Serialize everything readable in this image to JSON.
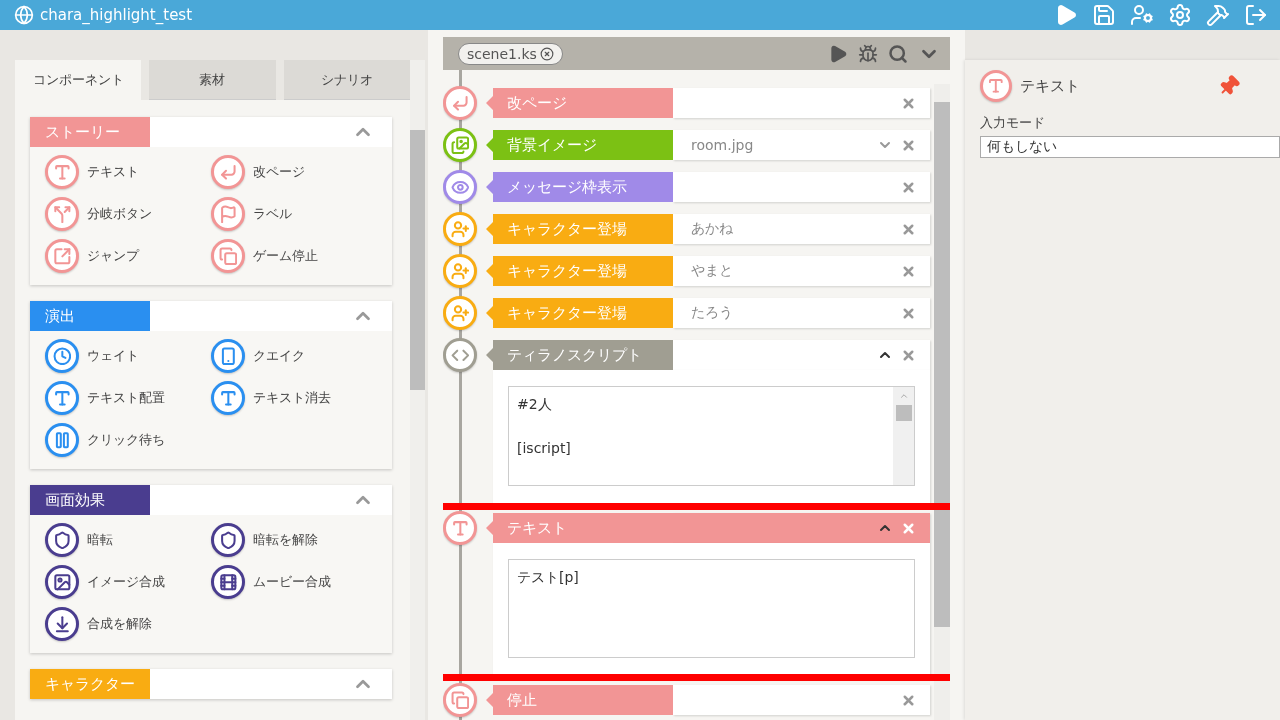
{
  "window": {
    "title": "chara_highlight_test"
  },
  "left_panel": {
    "tabs": [
      {
        "label": "コンポーネント",
        "selected": true
      },
      {
        "label": "素材",
        "selected": false
      },
      {
        "label": "シナリオ",
        "selected": false
      }
    ],
    "sections": [
      {
        "title": "ストーリー",
        "color": "#f29595",
        "items": [
          {
            "label": "テキスト",
            "kind": "text"
          },
          {
            "label": "改ページ",
            "kind": "newpage"
          },
          {
            "label": "分岐ボタン",
            "kind": "branch"
          },
          {
            "label": "ラベル",
            "kind": "label"
          },
          {
            "label": "ジャンプ",
            "kind": "jump"
          },
          {
            "label": "ゲーム停止",
            "kind": "stop"
          }
        ]
      },
      {
        "title": "演出",
        "color": "#2a8ff0",
        "items": [
          {
            "label": "ウェイト",
            "kind": "wait"
          },
          {
            "label": "クエイク",
            "kind": "quake"
          },
          {
            "label": "テキスト配置",
            "kind": "text"
          },
          {
            "label": "テキスト消去",
            "kind": "text"
          },
          {
            "label": "クリック待ち",
            "kind": "click"
          }
        ]
      },
      {
        "title": "画面効果",
        "color": "#4a3d8f",
        "items": [
          {
            "label": "暗転",
            "kind": "fade"
          },
          {
            "label": "暗転を解除",
            "kind": "fade"
          },
          {
            "label": "イメージ合成",
            "kind": "image"
          },
          {
            "label": "ムービー合成",
            "kind": "movie"
          },
          {
            "label": "合成を解除",
            "kind": "unmerge"
          }
        ]
      },
      {
        "title": "キャラクター",
        "color": "#f9ac12"
      }
    ]
  },
  "editor": {
    "file_tab": "scene1.ks",
    "blocks": [
      {
        "label": "改ページ",
        "color": "#f29595",
        "kind": "newpage",
        "expanded": false,
        "selected": false
      },
      {
        "label": "背景イメージ",
        "color": "#7cc114",
        "kind": "bg",
        "value": "room.jpg",
        "expanded": false,
        "selected": false
      },
      {
        "label": "メッセージ枠表示",
        "color": "#a08ae8",
        "kind": "message",
        "expanded": false,
        "selected": false
      },
      {
        "label": "キャラクター登場",
        "color": "#f9ac12",
        "kind": "chara",
        "value": "あかね",
        "expanded": false,
        "selected": false
      },
      {
        "label": "キャラクター登場",
        "color": "#f9ac12",
        "kind": "chara",
        "value": "やまと",
        "expanded": false,
        "selected": false
      },
      {
        "label": "キャラクター登場",
        "color": "#f9ac12",
        "kind": "chara",
        "value": "たろう",
        "expanded": false,
        "selected": false
      },
      {
        "label": "ティラノスクリプト",
        "color": "#a09e92",
        "kind": "script",
        "expanded": true,
        "selected": false,
        "content": "#2人\n\n[iscript]"
      },
      {
        "label": "テキスト",
        "color": "#f29595",
        "kind": "text",
        "expanded": true,
        "selected": true,
        "content": "テスト[p]"
      },
      {
        "label": "停止",
        "color": "#f29595",
        "kind": "stop",
        "expanded": false,
        "selected": false
      }
    ]
  },
  "inspector": {
    "title": "テキスト",
    "field_label": "入力モード",
    "select_value": "何もしない"
  }
}
